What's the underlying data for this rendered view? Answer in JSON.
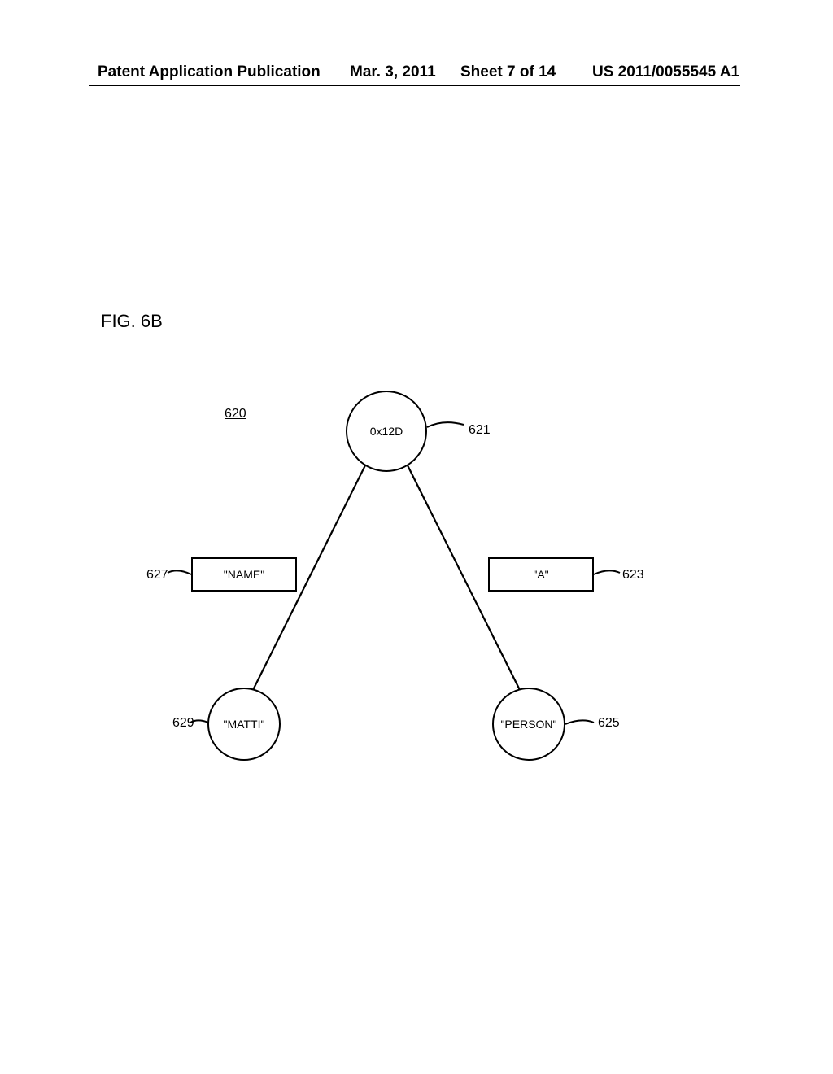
{
  "header": {
    "left": "Patent Application Publication",
    "date": "Mar. 3, 2011",
    "sheet": "Sheet 7 of 14",
    "pubnum": "US 2011/0055545 A1"
  },
  "figure": {
    "label": "FIG. 6B",
    "group_ref": "620"
  },
  "nodes": {
    "root": {
      "text": "0x12D",
      "ref": "621"
    },
    "rect_l": {
      "text": "\"NAME\"",
      "ref": "627"
    },
    "rect_r": {
      "text": "\"A\"",
      "ref": "623"
    },
    "circ_l": {
      "text": "\"MATTI\"",
      "ref": "629"
    },
    "circ_r": {
      "text": "\"PERSON\"",
      "ref": "625"
    }
  }
}
